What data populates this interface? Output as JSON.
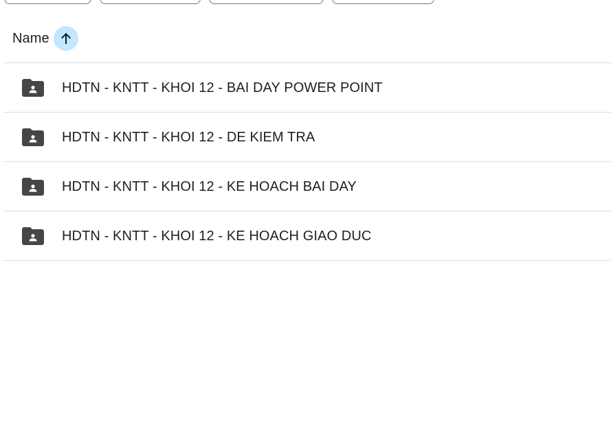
{
  "header": {
    "sort_column_label": "Name",
    "sort_direction_icon": "arrow-upward-icon"
  },
  "files": [
    {
      "name": "HDTN - KNTT - KHOI 12 - BAI DAY POWER POINT",
      "icon": "shared-folder-icon"
    },
    {
      "name": "HDTN - KNTT - KHOI 12 - DE KIEM TRA",
      "icon": "shared-folder-icon"
    },
    {
      "name": "HDTN - KNTT - KHOI 12 - KE HOACH BAI DAY",
      "icon": "shared-folder-icon"
    },
    {
      "name": "HDTN - KNTT - KHOI 12 - KE HOACH GIAO DUC",
      "icon": "shared-folder-icon"
    }
  ],
  "colors": {
    "sort_button_bg": "#c2e7ff",
    "sort_arrow": "#001d35",
    "folder_icon": "#444746",
    "divider": "#dadce0",
    "text": "#1f1f1f"
  }
}
